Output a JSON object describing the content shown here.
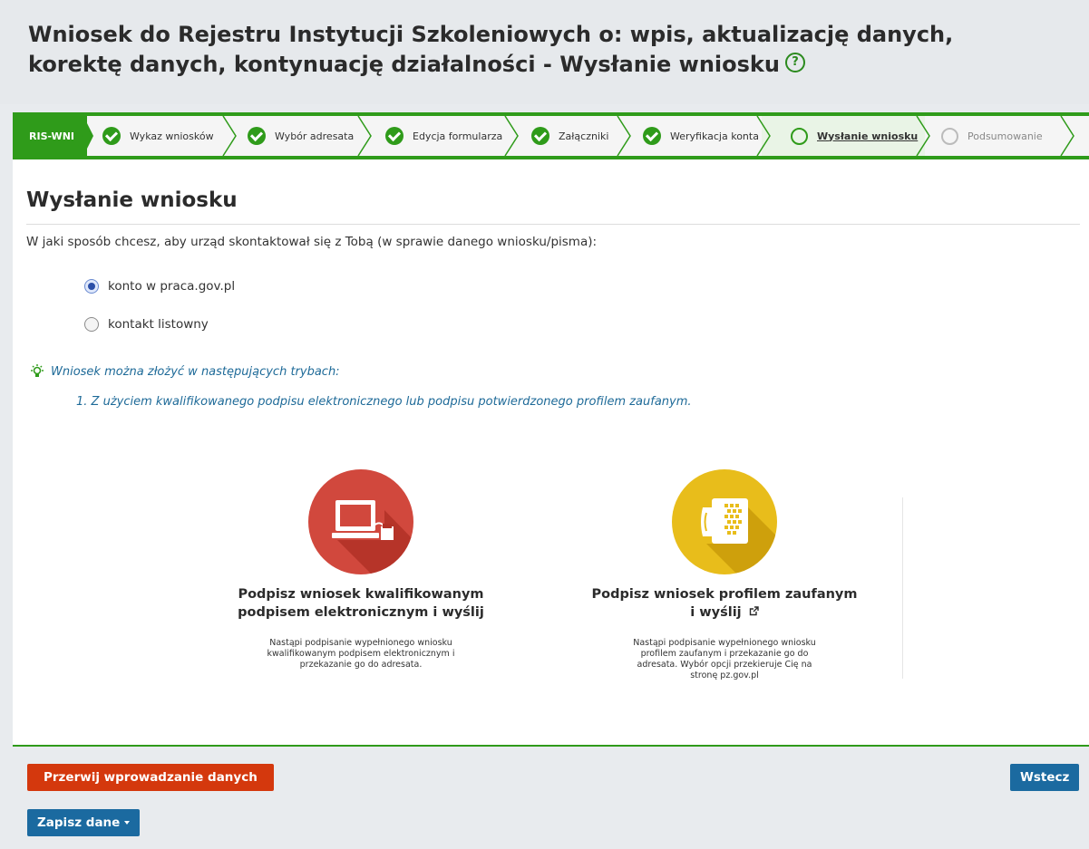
{
  "header": {
    "title": "Wniosek do Rejestru Instytucji Szkoleniowych o: wpis, aktualizację danych, korektę danych, kontynuację działalności - Wysłanie wniosku",
    "help_icon": "?"
  },
  "steps": {
    "code": "RIS-WNI",
    "items": [
      {
        "label": "Wykaz wniosków",
        "state": "done"
      },
      {
        "label": "Wybór adresata",
        "state": "done"
      },
      {
        "label": "Edycja formularza",
        "state": "done"
      },
      {
        "label": "Załączniki",
        "state": "done"
      },
      {
        "label": "Weryfikacja konta",
        "state": "done"
      },
      {
        "label": "Wysłanie wniosku",
        "state": "current"
      },
      {
        "label": "Podsumowanie",
        "state": "future"
      }
    ]
  },
  "main": {
    "heading": "Wysłanie wniosku",
    "question": "W jaki sposób chcesz, aby urząd skontaktował się z Tobą (w sprawie danego wniosku/pisma):",
    "contact_options": [
      {
        "label": "konto w praca.gov.pl",
        "selected": true
      },
      {
        "label": "kontakt listowny",
        "selected": false
      }
    ],
    "hint": "Wniosek można złożyć w następujących trybach:",
    "hint_items": [
      "1. Z użyciem kwalifikowanego podpisu elektronicznego lub podpisu potwierdzonego profilem zaufanym."
    ],
    "sign_options": [
      {
        "title_line1": "Podpisz wniosek kwalifikowanym",
        "title_line2": "podpisem elektronicznym i wyślij",
        "description": "Nastąpi podpisanie wypełnionego wniosku kwalifikowanym podpisem elektronicznym i przekazanie go do adresata.",
        "icon": "computer-card-reader-icon",
        "color": "#d1483d"
      },
      {
        "title_line1": "Podpisz wniosek profilem zaufanym",
        "title_line2": "i wyślij",
        "description": "Nastąpi podpisanie wypełnionego wniosku profilem zaufanym i przekazanie go do adresata. Wybór opcji przekieruje Cię na stronę pz.gov.pl",
        "icon": "trusted-profile-icon",
        "color": "#e8bd1b"
      }
    ]
  },
  "footer": {
    "cancel_label": "Przerwij wprowadzanie danych",
    "back_label": "Wstecz",
    "save_label": "Zapisz dane"
  },
  "colors": {
    "accent_green": "#2f9b1a",
    "danger": "#d4380d",
    "primary": "#1b6aa0",
    "hint": "#1e6a98"
  }
}
